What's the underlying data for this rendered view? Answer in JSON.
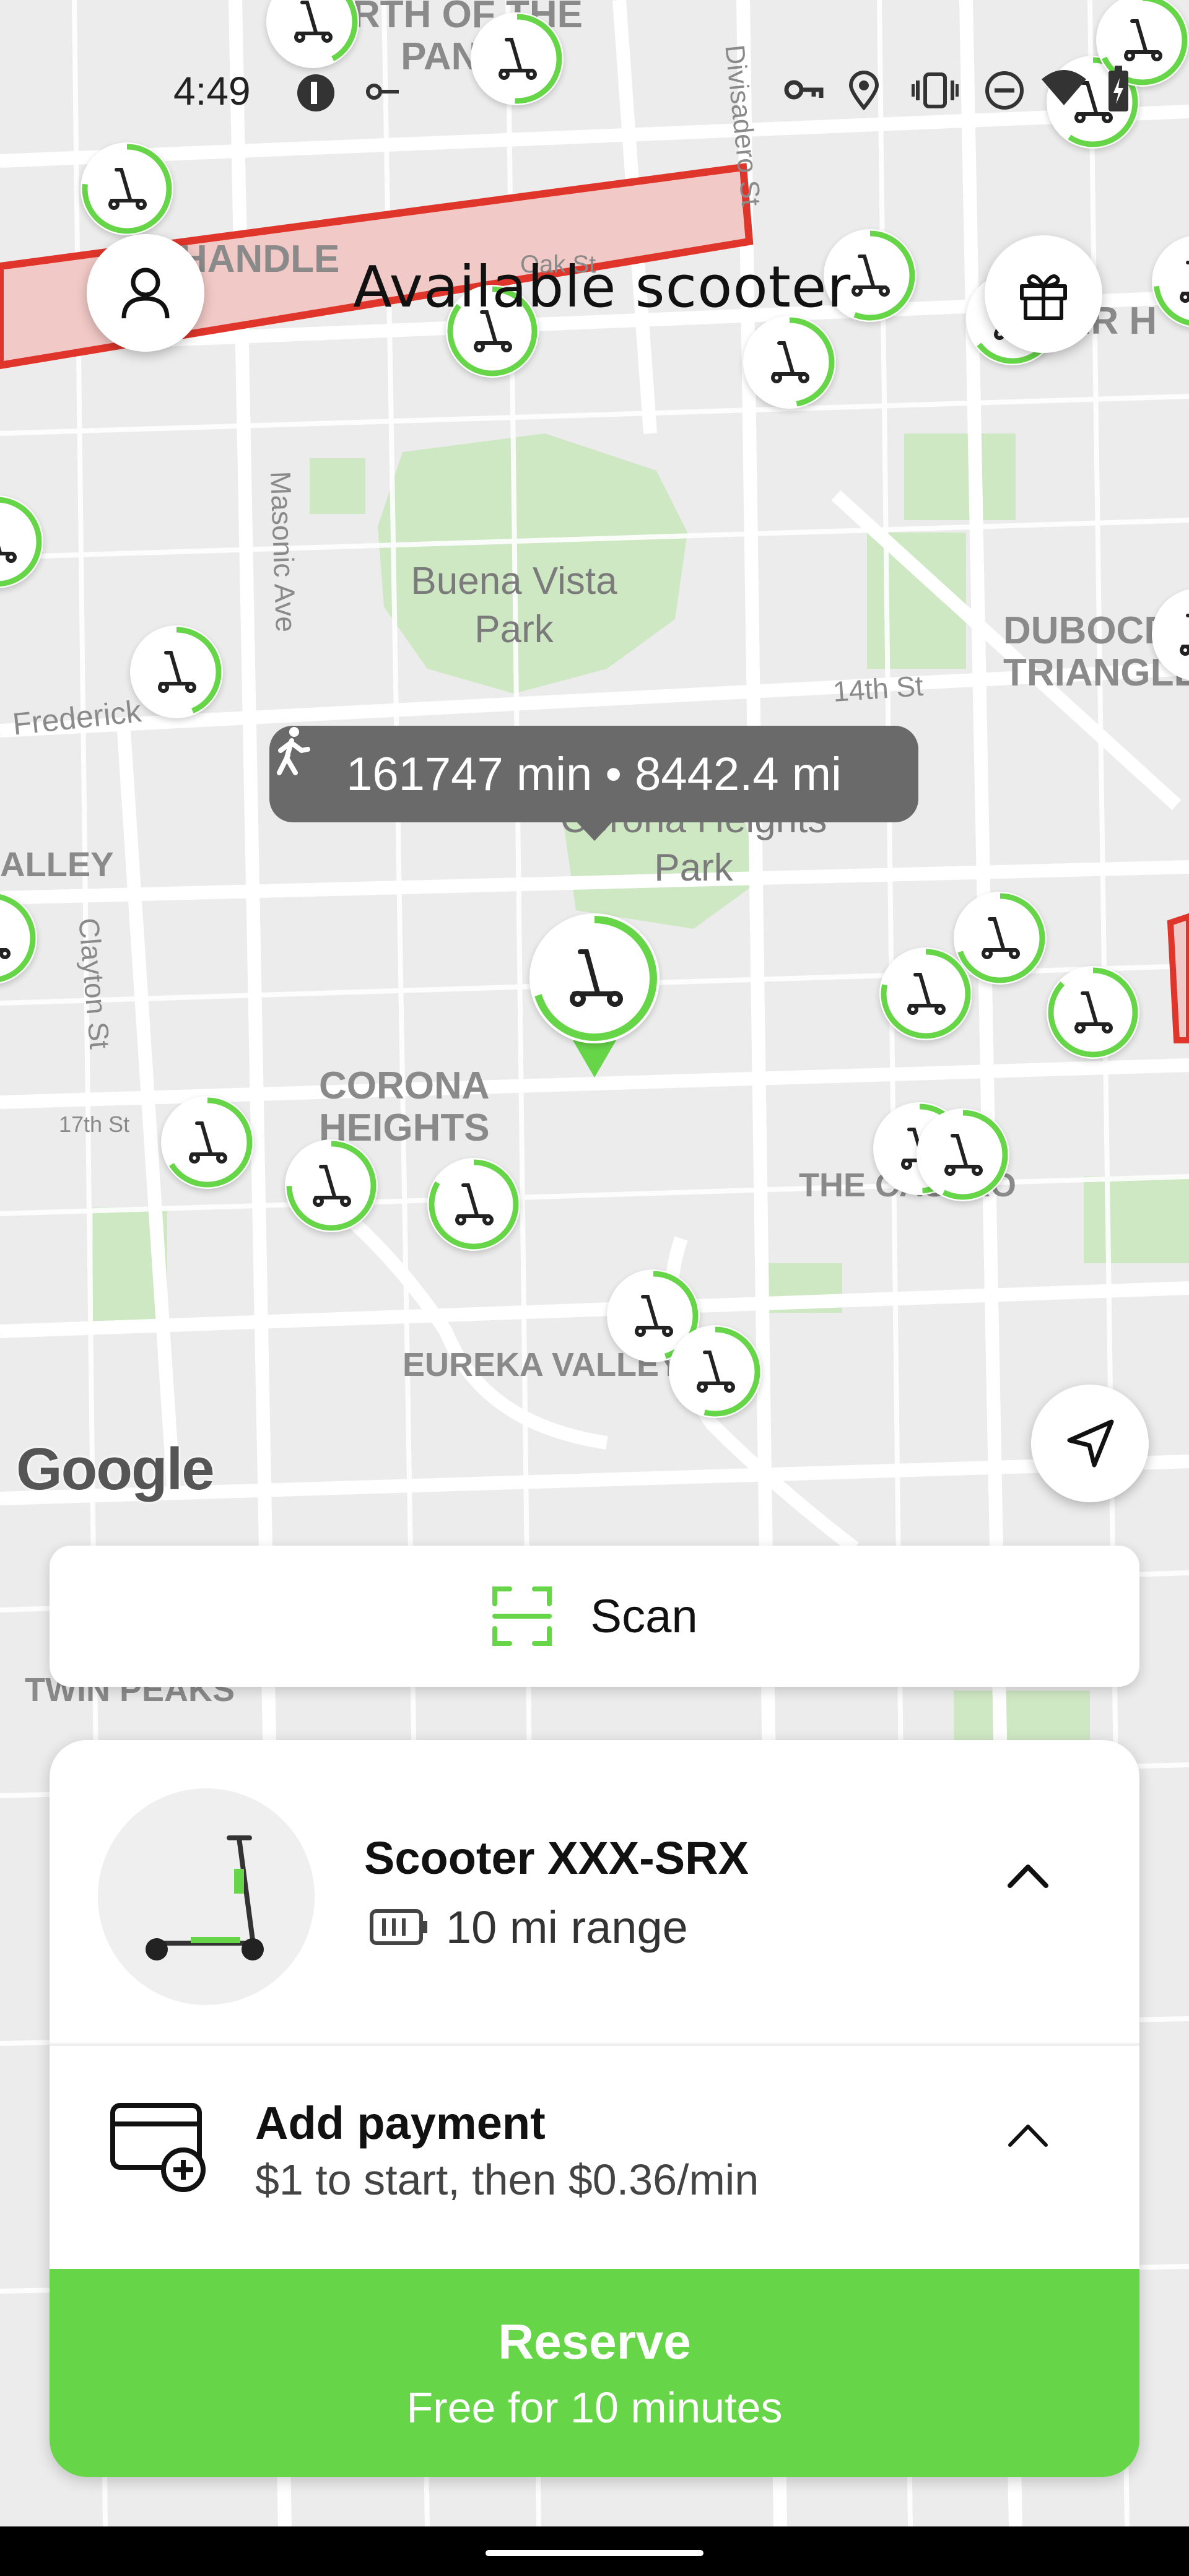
{
  "status_bar": {
    "time": "4:49"
  },
  "header": {
    "title": "Available scooter"
  },
  "map": {
    "labels": {
      "north_panhandle": "RTH OF THE PANHA",
      "panhandle": "HANDLE",
      "buena_vista": "Buena Vista Park",
      "duboce": "DUBOCE TRIANGLE",
      "corona_heights_park": "Corona Heights Park",
      "corona_heights": "CORONA HEIGHTS",
      "the_castro": "THE CASTRO",
      "eureka_valley": "EUREKA VALLEY",
      "twin_peaks": "TWIN PEAKS",
      "alley": "ALLEY",
      "frederick": "Frederick",
      "clayton": "Clayton St",
      "masonic": "Masonic Ave",
      "divisadero": "Divisadero St",
      "fourteenth": "14th St",
      "seventeenth": "17th St",
      "oak": "Oak St",
      "er_h": "ER H"
    },
    "walk_info": "161747 min • 8442.4 mi",
    "google_label": "Google"
  },
  "scan": {
    "label": "Scan"
  },
  "scooter": {
    "name": "Scooter XXX-SRX",
    "range": "10 mi range"
  },
  "payment": {
    "title": "Add payment",
    "subtitle": "$1 to start, then $0.36/min"
  },
  "reserve": {
    "title": "Reserve",
    "subtitle": "Free for 10 minutes"
  },
  "colors": {
    "accent": "#66d648",
    "zone_red": "#e0352b"
  }
}
